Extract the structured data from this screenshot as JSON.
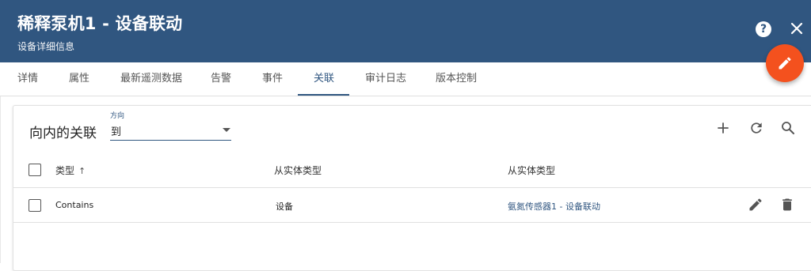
{
  "header": {
    "title": "稀释泵机1 - 设备联动",
    "subtitle": "设备详细信息",
    "help_icon_text": "?",
    "bg_color": "#305680",
    "fab_color": "#f4511e"
  },
  "tabs": [
    {
      "label": "详情",
      "active": false
    },
    {
      "label": "属性",
      "active": false
    },
    {
      "label": "最新遥测数据",
      "active": false
    },
    {
      "label": "告警",
      "active": false
    },
    {
      "label": "事件",
      "active": false
    },
    {
      "label": "关联",
      "active": true
    },
    {
      "label": "审计日志",
      "active": false
    },
    {
      "label": "版本控制",
      "active": false
    }
  ],
  "relations": {
    "title": "向内的关联",
    "direction": {
      "label": "方向",
      "value": "到"
    },
    "toolbar": {
      "add_icon": "add-icon",
      "refresh_icon": "refresh-icon",
      "search_icon": "search-icon"
    },
    "columns": [
      {
        "label": "类型",
        "sort": "asc"
      },
      {
        "label": "从实体类型"
      },
      {
        "label": "从实体类型"
      }
    ],
    "rows": [
      {
        "type": "Contains",
        "entity_type": "设备",
        "entity_name": "氨氮传感器1 - 设备联动",
        "actions": [
          "edit-icon",
          "delete-icon"
        ]
      }
    ]
  }
}
